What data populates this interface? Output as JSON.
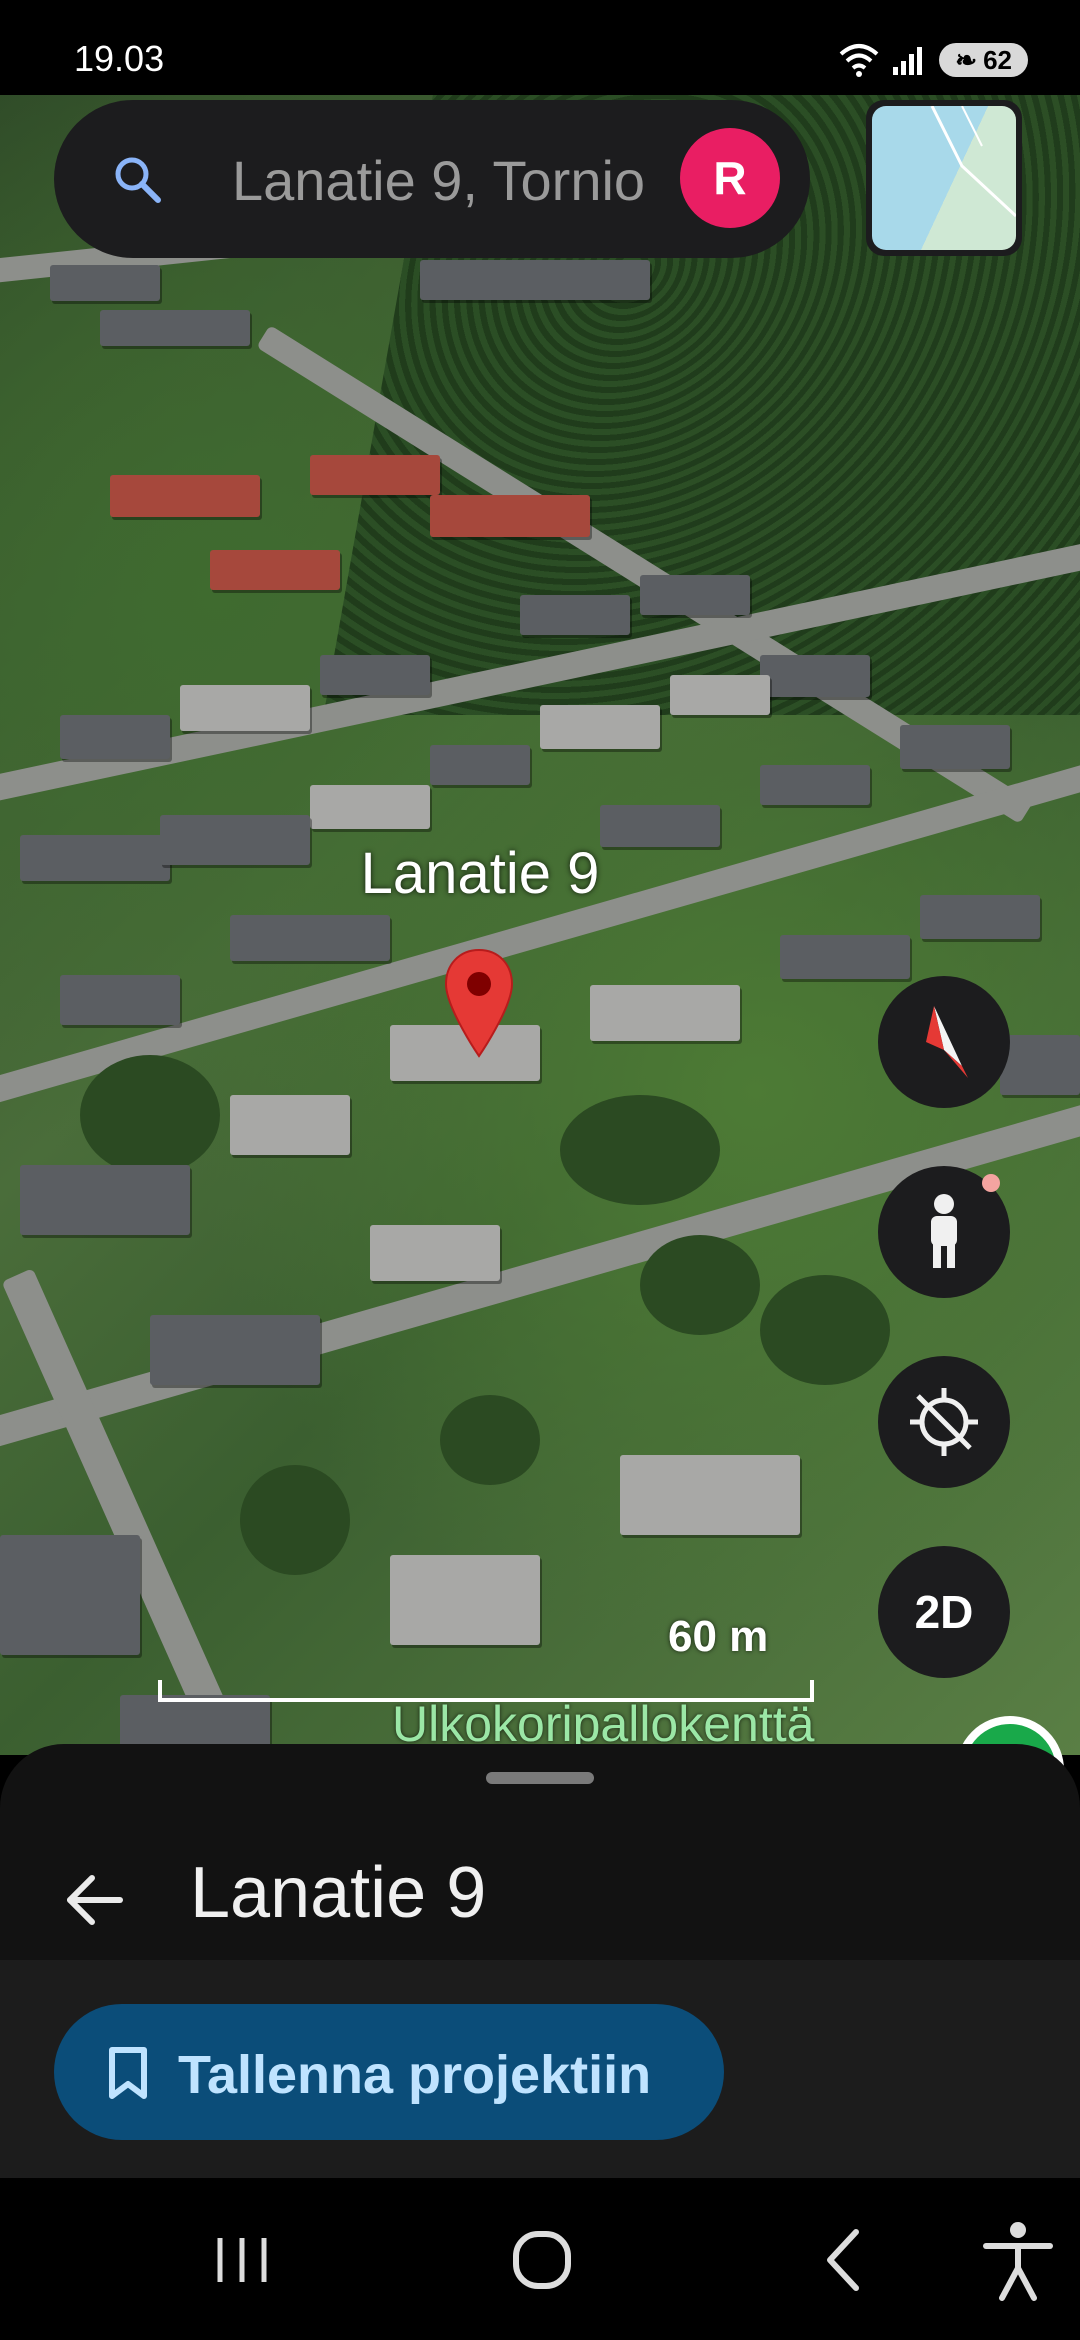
{
  "status_bar": {
    "time": "19.03",
    "battery": "62"
  },
  "search": {
    "text": "Lanatie 9, Tornio",
    "avatar_initial": "R"
  },
  "map": {
    "pin_label": "Lanatie 9",
    "scale_label": "60 m",
    "place_label": "Ulkokoripallokenttä",
    "view_mode_label": "2D"
  },
  "sheet": {
    "title": "Lanatie 9",
    "save_button_label": "Tallenna projektiin"
  },
  "icons": {
    "search": "search-icon",
    "compass": "compass-icon",
    "pegman": "pegman-icon",
    "location": "my-location-icon",
    "back": "back-arrow-icon",
    "bookmark": "bookmark-icon",
    "recents": "recents-icon",
    "home": "home-icon",
    "nav_back": "nav-back-icon",
    "accessibility": "accessibility-icon"
  },
  "colors": {
    "accent": "#e91e63",
    "save_button_bg": "#0b4d79",
    "save_button_text": "#bfe3ff",
    "pin": "#e53935"
  }
}
